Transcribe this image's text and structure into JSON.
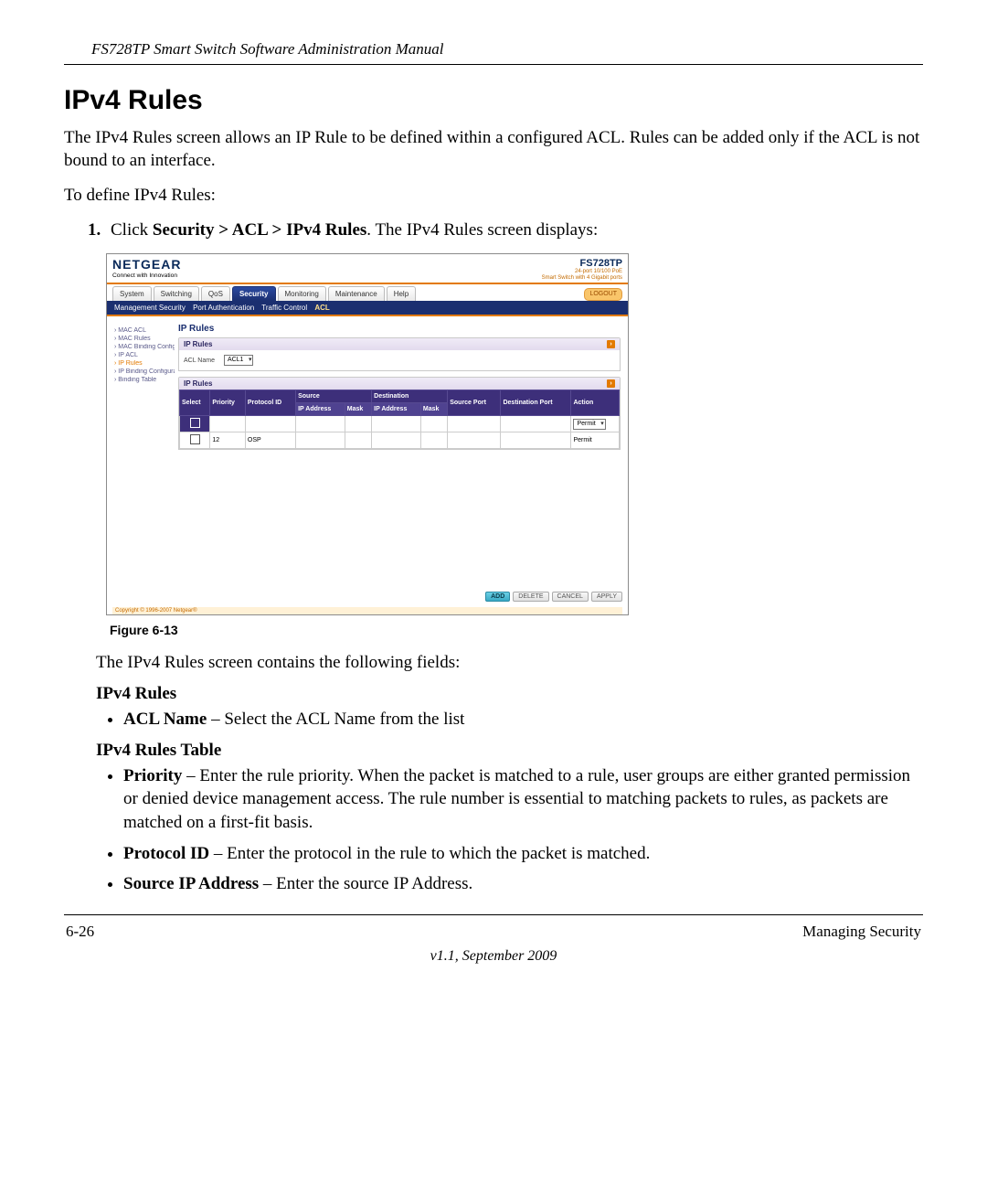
{
  "doc_header": "FS728TP Smart Switch Software Administration Manual",
  "section_title": "IPv4 Rules",
  "intro": "The IPv4 Rules screen allows an IP Rule to be defined within a configured ACL. Rules can be added only if the ACL is not bound to an interface.",
  "to_define": "To define IPv4 Rules:",
  "step1_prefix": "Click ",
  "step1_path": "Security > ACL > IPv4 Rules",
  "step1_suffix": ". The IPv4 Rules screen displays:",
  "figure_label": "Figure 6-13",
  "after_figure": "The IPv4 Rules screen contains the following fields:",
  "group1_title": "IPv4 Rules",
  "group1_items": [
    {
      "term": "ACL Name",
      "desc": " – Select the ACL Name from the list"
    }
  ],
  "group2_title": "IPv4 Rules Table",
  "group2_items": [
    {
      "term": "Priority",
      "desc": " – Enter the rule priority. When the packet is matched to a rule, user groups are either granted permission or denied device management access. The rule number is essential to matching packets to rules, as packets are matched on a first-fit basis."
    },
    {
      "term": "Protocol ID",
      "desc": " – Enter the protocol in the rule to which the packet is matched."
    },
    {
      "term": "Source IP Address",
      "desc": " – Enter the source IP Address."
    }
  ],
  "footer": {
    "page": "6-26",
    "section": "Managing Security",
    "version": "v1.1, September 2009"
  },
  "screenshot": {
    "brand": "NETGEAR",
    "brand_tag": "Connect with Innovation",
    "model": "FS728TP",
    "model_line1": "24-port 10/100 PoE",
    "model_line2": "Smart Switch with 4 Gigabit ports",
    "main_tabs": [
      "System",
      "Switching",
      "QoS",
      "Security",
      "Monitoring",
      "Maintenance",
      "Help"
    ],
    "main_tab_active": "Security",
    "logout": "LOGOUT",
    "sub_tabs": [
      "Management Security",
      "Port Authentication",
      "Traffic Control",
      "ACL"
    ],
    "sub_tab_active": "ACL",
    "sidebar": [
      {
        "label": "› MAC ACL"
      },
      {
        "label": "› MAC Rules"
      },
      {
        "label": "› MAC Binding Configuration"
      },
      {
        "label": "› IP ACL"
      },
      {
        "label": "› IP Rules",
        "current": true
      },
      {
        "label": "› IP Binding Configuration"
      },
      {
        "label": "› Binding Table"
      }
    ],
    "panel_main_title": "IP Rules",
    "panel1": {
      "title": "IP Rules",
      "acl_label": "ACL Name",
      "acl_value": "ACL1"
    },
    "panel2": {
      "title": "IP Rules",
      "headers": [
        "Select",
        "Priority",
        "Protocol ID"
      ],
      "source_h": "Source",
      "dest_h": "Destination",
      "srcport_h": "Source Port",
      "dstport_h": "Destination Port",
      "action_h": "Action",
      "sub_headers": [
        "IP Address",
        "Mask",
        "IP Address",
        "Mask"
      ],
      "row_add_action": "Permit",
      "row_existing": {
        "priority": "12",
        "protocol": "OSP",
        "action": "Permit"
      }
    },
    "buttons": {
      "add": "ADD",
      "delete": "DELETE",
      "cancel": "CANCEL",
      "apply": "APPLY"
    },
    "copyright": "Copyright © 1996-2007 Netgear®"
  }
}
